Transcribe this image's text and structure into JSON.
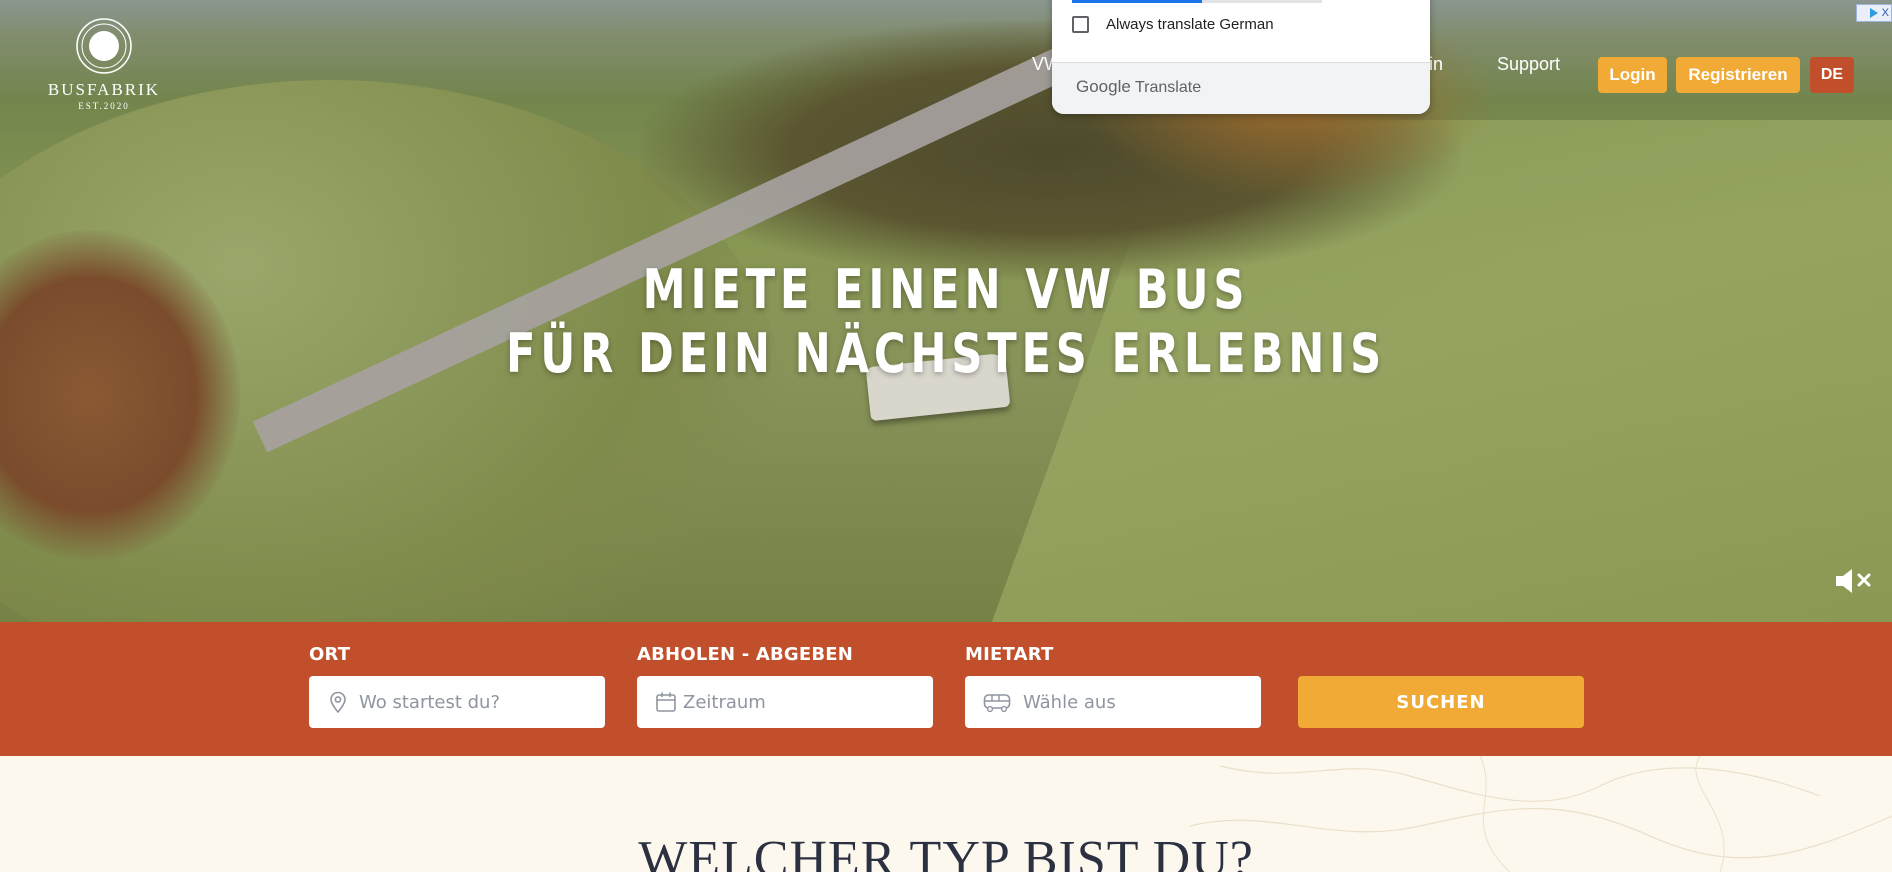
{
  "header": {
    "logo": {
      "name": "BUSFABRIK",
      "est": "EST.2020"
    },
    "nav": {
      "vw_partial": "VW",
      "magazin_partial": "zin",
      "support": "Support"
    },
    "buttons": {
      "login": "Login",
      "register": "Registrieren",
      "language": "DE"
    }
  },
  "hero": {
    "title_line1": "MIETE EINEN VW BUS",
    "title_line2": "FÜR DEIN NÄCHSTES ERLEBNIS",
    "mute_icon": "speaker-muted-icon"
  },
  "translate_popup": {
    "always_translate_label": "Always translate German",
    "brand_google": "Google",
    "brand_translate": "Translate",
    "always_translate_checked": false
  },
  "ad_badge": {
    "close_glyph": "X"
  },
  "search": {
    "location": {
      "label": "ORT",
      "placeholder": "Wo startest du?",
      "icon": "location-pin-icon"
    },
    "dates": {
      "label": "ABHOLEN - ABGEBEN",
      "placeholder": "Zeitraum",
      "icon": "calendar-icon"
    },
    "rental_type": {
      "label": "MIETART",
      "placeholder": "Wähle aus",
      "icon": "bus-icon"
    },
    "submit_label": "SUCHEN"
  },
  "section": {
    "heading": "WELCHER TYP BIST DU?"
  },
  "colors": {
    "brand_orange": "#c24f2b",
    "accent_yellow": "#f0aa35",
    "cream": "#fdf8ee"
  }
}
